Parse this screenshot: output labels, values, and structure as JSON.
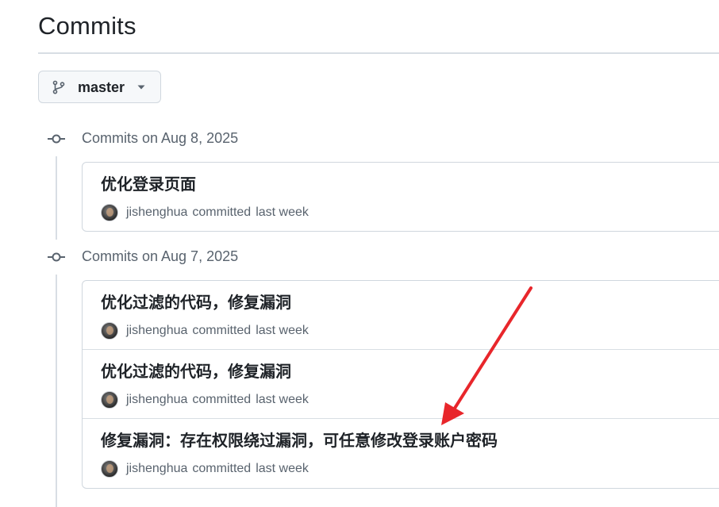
{
  "page": {
    "title": "Commits"
  },
  "branch_selector": {
    "label": "master",
    "icon": "git-branch-icon",
    "caret_icon": "triangle-down-icon"
  },
  "colors": {
    "annotation_arrow": "#e8262b",
    "timeline": "#d8dee4",
    "muted_text": "#59636e",
    "border": "#d0d7de"
  },
  "commit_groups": [
    {
      "heading": "Commits on Aug 8, 2025",
      "commits": [
        {
          "message": "优化登录页面",
          "author": "jishenghua",
          "verb": "committed",
          "time": "last week"
        }
      ]
    },
    {
      "heading": "Commits on Aug 7, 2025",
      "commits": [
        {
          "message": "优化过滤的代码，修复漏洞",
          "author": "jishenghua",
          "verb": "committed",
          "time": "last week"
        },
        {
          "message": "优化过滤的代码，修复漏洞",
          "author": "jishenghua",
          "verb": "committed",
          "time": "last week"
        },
        {
          "message": "修复漏洞：存在权限绕过漏洞，可任意修改登录账户密码",
          "author": "jishenghua",
          "verb": "committed",
          "time": "last week"
        }
      ]
    }
  ]
}
